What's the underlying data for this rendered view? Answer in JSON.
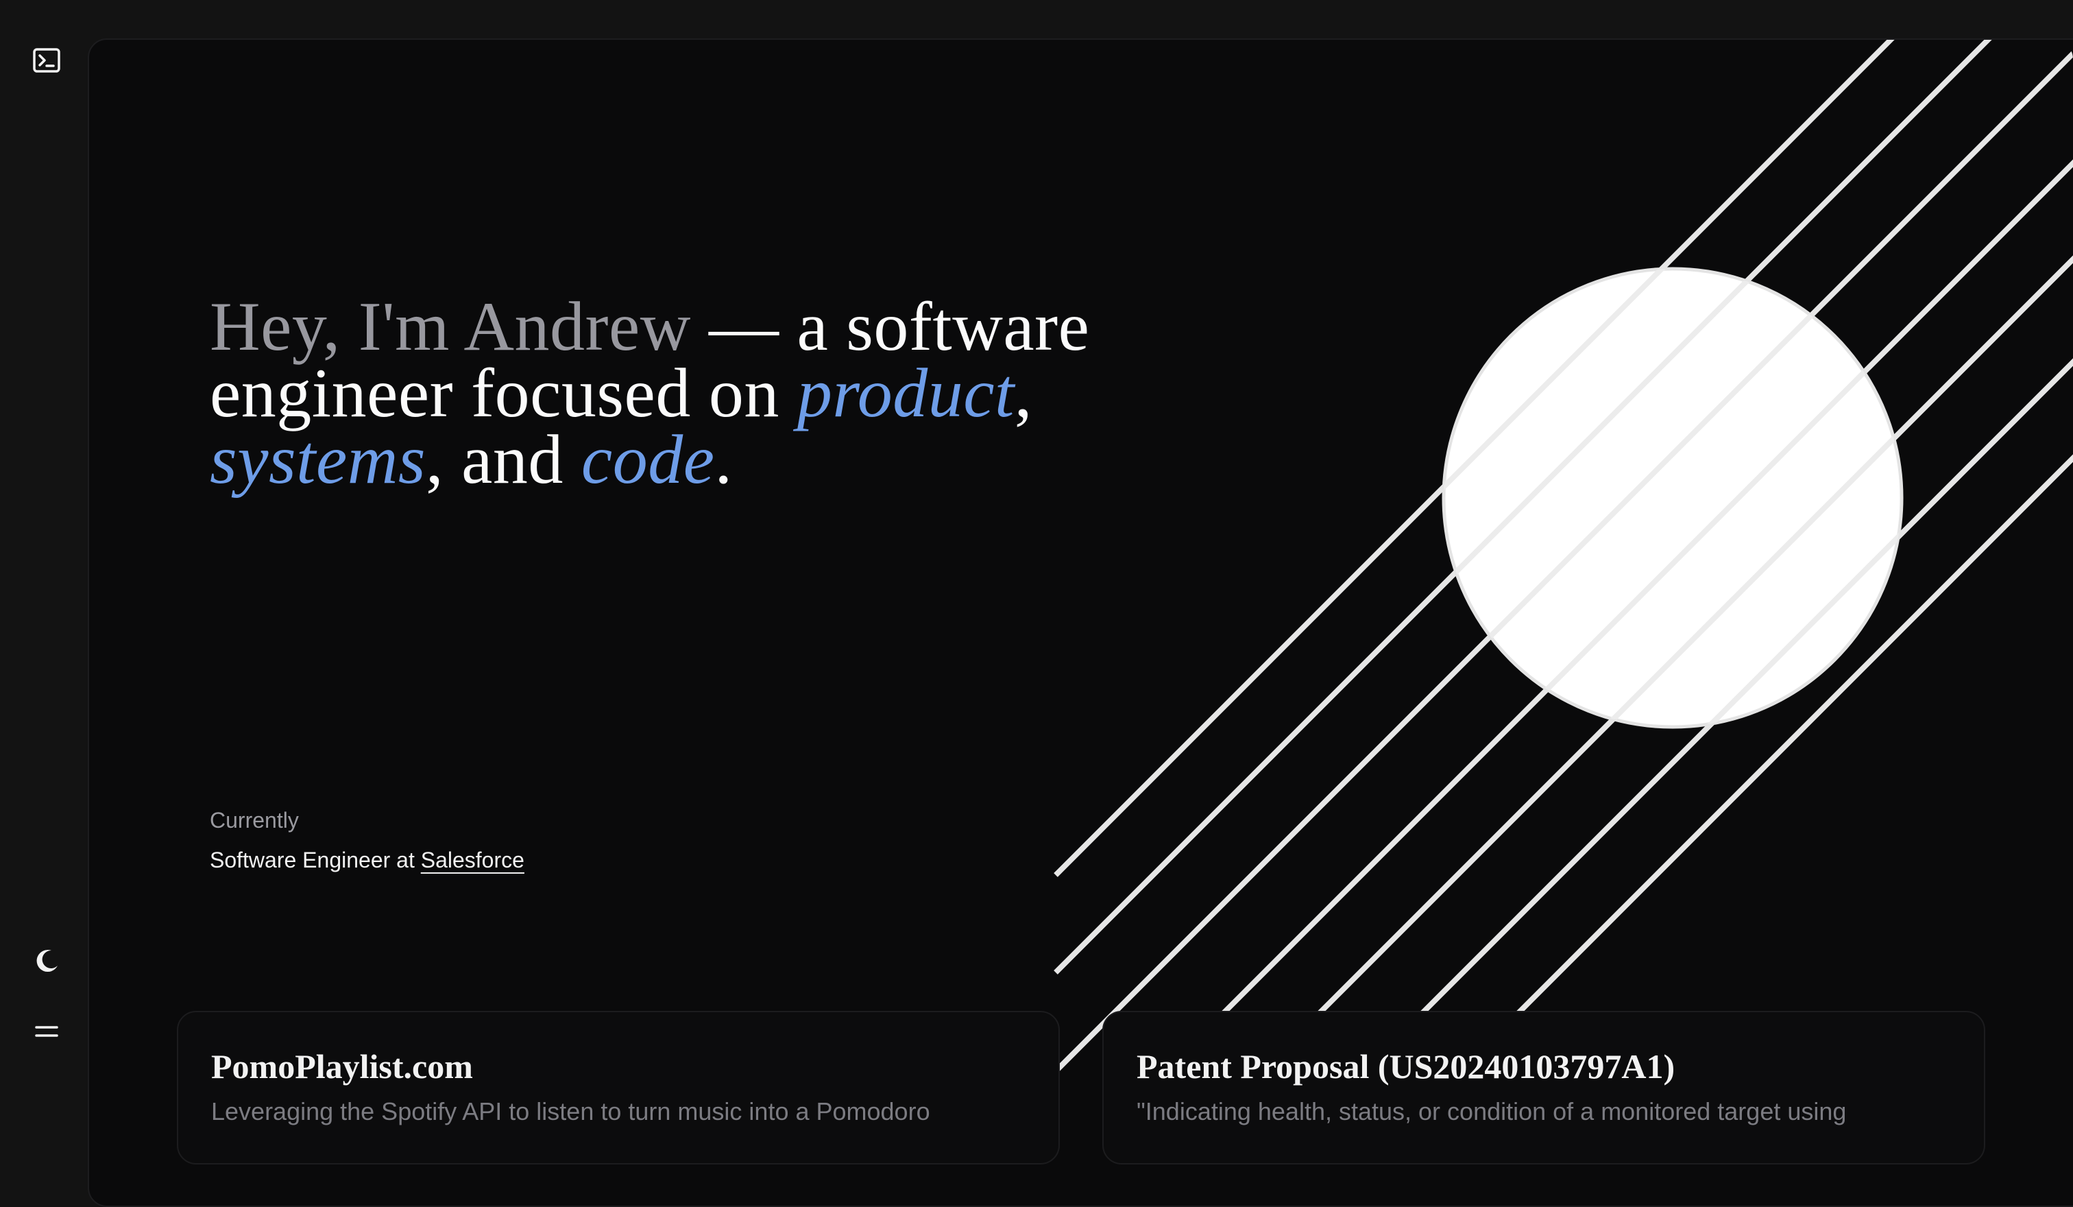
{
  "sidebar": {
    "icons": [
      "terminal-icon",
      "moon-icon",
      "menu-icon"
    ]
  },
  "hero": {
    "intro": "Hey, I'm Andrew",
    "dash_text": " — a software engineer focused on ",
    "word_product": "product",
    "comma_1": ",",
    "word_systems": "systems",
    "and_text": ", and ",
    "word_code": "code",
    "period": "."
  },
  "currently": {
    "label": "Currently",
    "role_prefix": "Software Engineer at ",
    "company": "Salesforce"
  },
  "projects": [
    {
      "title": "PomoPlaylist.com",
      "description": "Leveraging the Spotify API to listen to turn music into a Pomodoro"
    },
    {
      "title": "Patent Proposal (US20240103797A1)",
      "description": "\"Indicating health, status, or condition of a monitored target using"
    }
  ],
  "colors": {
    "accent": "#6e9de8",
    "background": "#0a0a0b",
    "sidebar": "#131313",
    "text": "#fbfbfb",
    "muted": "#98989f"
  }
}
